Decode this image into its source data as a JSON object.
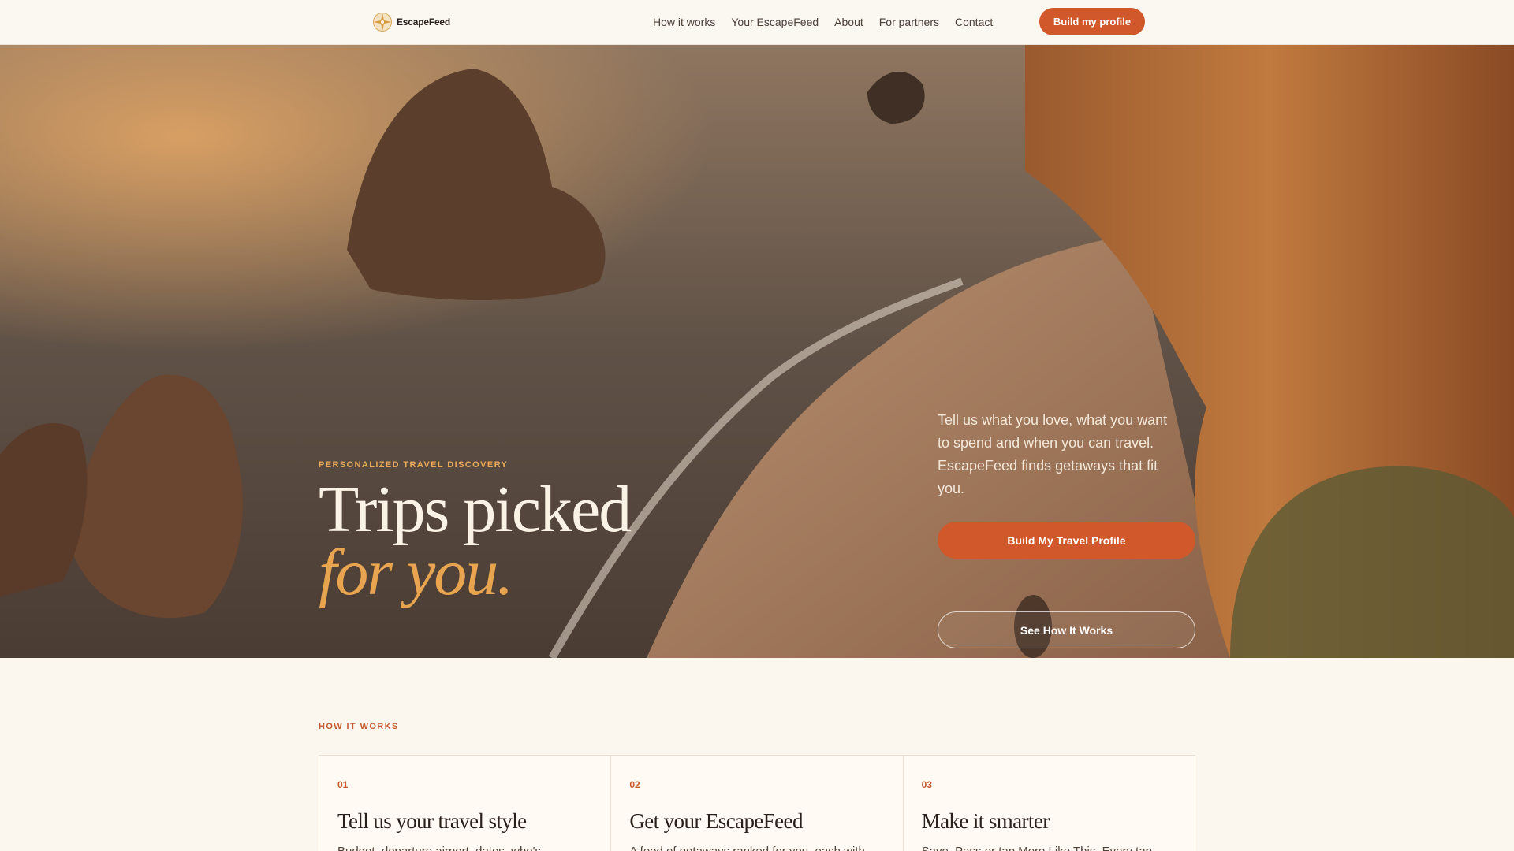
{
  "brand": {
    "name": "EscapeFeed"
  },
  "nav": {
    "items": [
      {
        "label": "How it works"
      },
      {
        "label": "Your EscapeFeed"
      },
      {
        "label": "About"
      },
      {
        "label": "For partners"
      },
      {
        "label": "Contact"
      }
    ],
    "cta_label": "Build my profile"
  },
  "hero": {
    "eyebrow": "PERSONALIZED TRAVEL DISCOVERY",
    "title_main": "Trips picked ",
    "title_accent": "for you.",
    "description": "Tell us what you love, what you want to spend and when you can travel. EscapeFeed finds getaways that fit you.",
    "primary_button": "Build My Travel Profile",
    "secondary_button": "See How It Works"
  },
  "how_it_works": {
    "eyebrow": "HOW IT WORKS",
    "steps": [
      {
        "number": "01",
        "title": "Tell us your travel style",
        "description": "Budget, departure airport, dates, who's"
      },
      {
        "number": "02",
        "title": "Get your EscapeFeed",
        "description": "A feed of getaways ranked for you, each with"
      },
      {
        "number": "03",
        "title": "Make it smarter",
        "description": "Save, Pass or tap More Like This. Every tap"
      }
    ]
  },
  "colors": {
    "accent": "#d0582a",
    "gold": "#e8a44f",
    "background": "#fbf6ee"
  }
}
